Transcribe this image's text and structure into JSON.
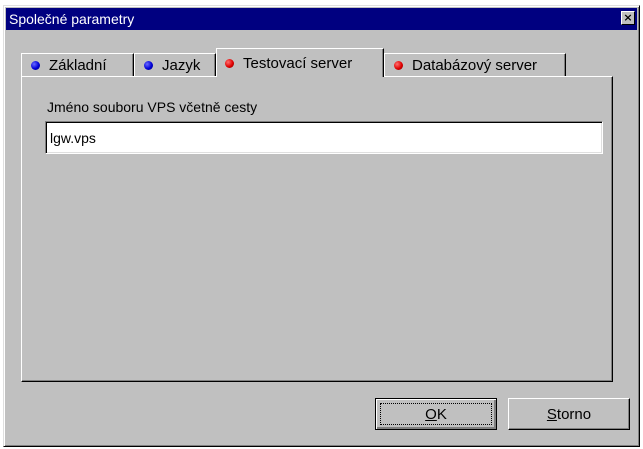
{
  "window": {
    "title": "Společné parametry",
    "close_glyph": "×"
  },
  "tabs": [
    {
      "label": "Základní",
      "dot_color": "#0000d8",
      "active": false
    },
    {
      "label": "Jazyk",
      "dot_color": "#0000d8",
      "active": false
    },
    {
      "label": "Testovací server",
      "dot_color": "#e00000",
      "active": true
    },
    {
      "label": "Databázový server",
      "dot_color": "#e00000",
      "active": false
    }
  ],
  "panel": {
    "field_label": "Jméno souboru VPS včetně cesty",
    "field_value": "lgw.vps"
  },
  "buttons": {
    "ok": {
      "mnemonic": "O",
      "rest": "K"
    },
    "cancel": {
      "mnemonic": "S",
      "rest": "torno"
    }
  }
}
